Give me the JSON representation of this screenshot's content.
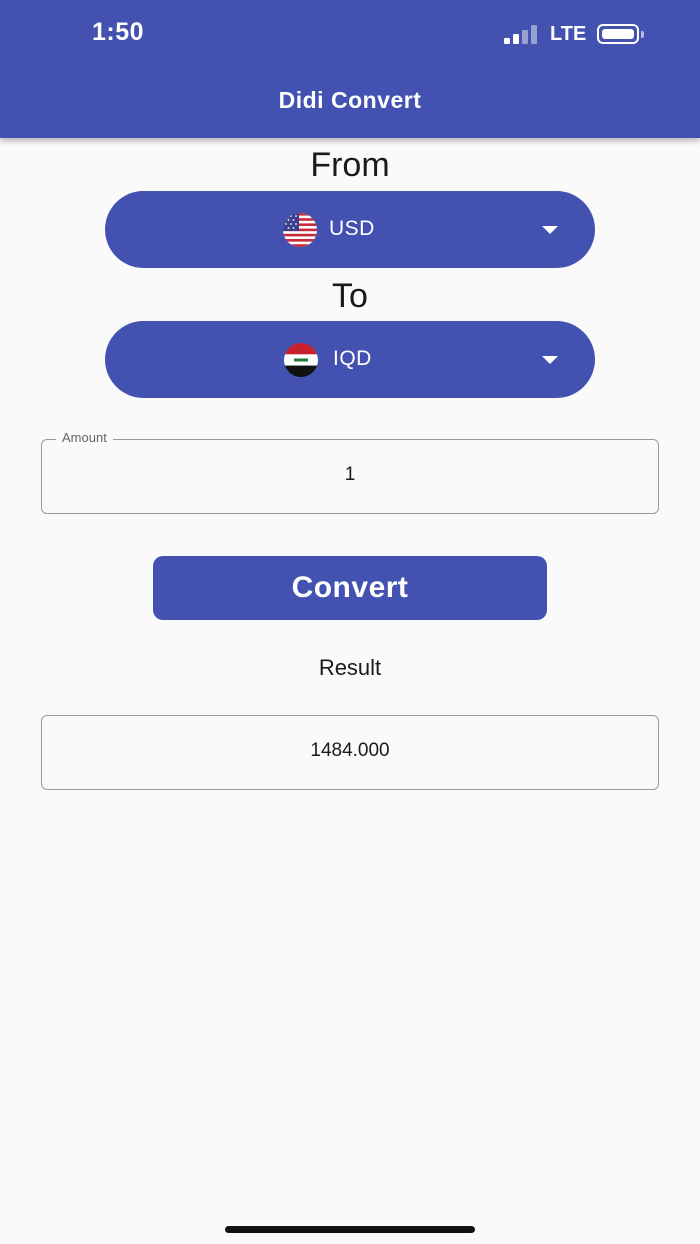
{
  "status_bar": {
    "time": "1:50",
    "network": "LTE"
  },
  "app_bar": {
    "title": "Didi Convert"
  },
  "converter": {
    "from_label": "From",
    "from_currency": {
      "code": "USD",
      "flag_icon": "us-flag-icon"
    },
    "to_label": "To",
    "to_currency": {
      "code": "IQD",
      "flag_icon": "iraq-flag-icon"
    },
    "amount_label": "Amount",
    "amount_value": "1",
    "convert_label": "Convert",
    "result_label": "Result",
    "result_value": "1484.000"
  },
  "colors": {
    "primary": "#4352b0",
    "background": "#fafafa"
  }
}
